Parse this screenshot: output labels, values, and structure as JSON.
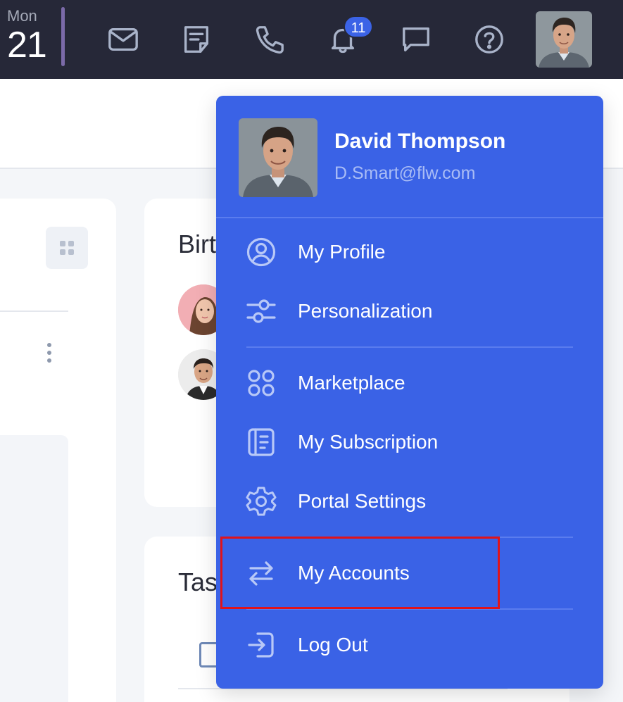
{
  "topbar": {
    "date": {
      "weekday": "Mon",
      "day": "21"
    },
    "icons": [
      "mail-icon",
      "note-icon",
      "phone-icon",
      "bell-icon",
      "chat-icon",
      "help-icon"
    ],
    "notifications_count": "11",
    "colors": {
      "bar": "#262838",
      "icon": "#a9b3c9",
      "badge": "#3b63e6",
      "accent": "#7b6aa8"
    }
  },
  "content": {
    "birthdays_title_fragment": "Birt",
    "tasks_title_fragment": "Tas"
  },
  "profile_menu": {
    "user": {
      "name": "David Thompson",
      "email": "D.Smart@flw.com"
    },
    "items": [
      {
        "id": "my-profile",
        "label": "My Profile",
        "icon": "user-circle-icon"
      },
      {
        "id": "personalization",
        "label": "Personalization",
        "icon": "sliders-icon"
      },
      {
        "id": "marketplace",
        "label": "Marketplace",
        "icon": "apps-grid-icon"
      },
      {
        "id": "my-subscription",
        "label": "My Subscription",
        "icon": "document-icon"
      },
      {
        "id": "portal-settings",
        "label": "Portal Settings",
        "icon": "gear-icon"
      },
      {
        "id": "my-accounts",
        "label": "My Accounts",
        "icon": "switch-arrows-icon",
        "highlighted": true
      },
      {
        "id": "log-out",
        "label": "Log Out",
        "icon": "logout-icon"
      }
    ],
    "colors": {
      "background": "#3a62e6",
      "text": "#ffffff",
      "icon": "#b8c8f7",
      "email": "#a9bcf5",
      "highlight_border": "#e0131b"
    }
  }
}
